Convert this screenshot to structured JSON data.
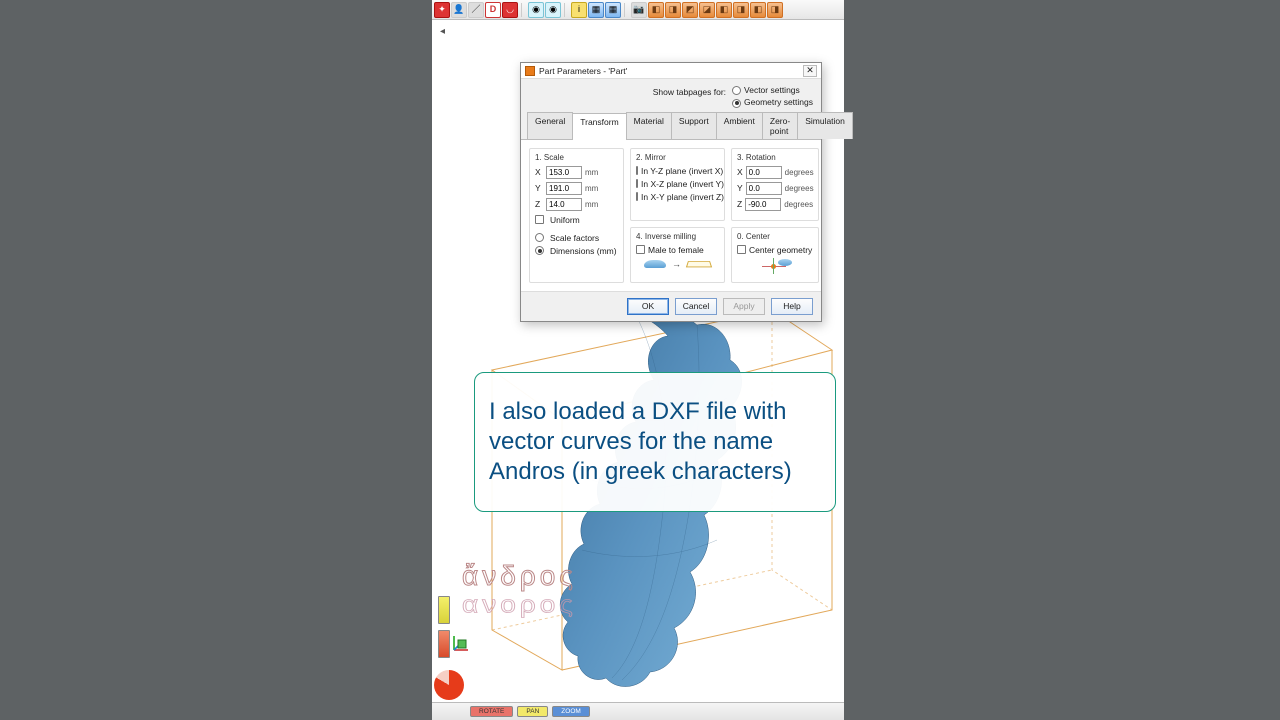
{
  "toolbar": {
    "groups": [
      "axes",
      "person",
      "ruler",
      "D",
      "cup",
      "sep",
      "cylinder",
      "cylinder2",
      "sep",
      "info",
      "grid1",
      "grid2",
      "sep",
      "camera",
      "cube1",
      "cube2",
      "cube3",
      "cube4",
      "cube5",
      "cube6",
      "cube7",
      "cube8"
    ]
  },
  "dialog": {
    "title": "Part Parameters - 'Part'",
    "tabpages_label": "Show tabpages for:",
    "radio_vector": "Vector settings",
    "radio_geometry": "Geometry settings",
    "radio_selected": "geometry",
    "tabs": [
      "General",
      "Transform",
      "Material",
      "Support",
      "Ambient",
      "Zero-point",
      "Simulation"
    ],
    "active_tab": 1,
    "scale": {
      "title": "1. Scale",
      "x": "153.0",
      "y": "191.0",
      "z": "14.0",
      "unit": "mm",
      "uniform_label": "Uniform",
      "mode_factors": "Scale factors",
      "mode_dims": "Dimensions (mm)",
      "mode_selected": "dims"
    },
    "mirror": {
      "title": "2. Mirror",
      "yz": "In Y-Z plane (invert X)",
      "xz": "In X-Z plane (invert Y)",
      "xy": "In X-Y plane (invert Z)"
    },
    "rotation": {
      "title": "3. Rotation",
      "x": "0.0",
      "y": "0.0",
      "z": "-90.0",
      "unit": "degrees"
    },
    "inverse": {
      "title": "4. Inverse milling",
      "label": "Male to female"
    },
    "center": {
      "title": "0. Center",
      "label": "Center geometry"
    },
    "buttons": {
      "ok": "OK",
      "cancel": "Cancel",
      "apply": "Apply",
      "help": "Help"
    }
  },
  "caption": "I also loaded a DXF file with vector curves for the name Andros (in greek characters)",
  "greek": {
    "line1": "ἄνδρος",
    "line2": "ανορος"
  },
  "statusbar": {
    "rotate": "ROTATE",
    "pan": "PAN",
    "zoom": "ZOOM"
  }
}
